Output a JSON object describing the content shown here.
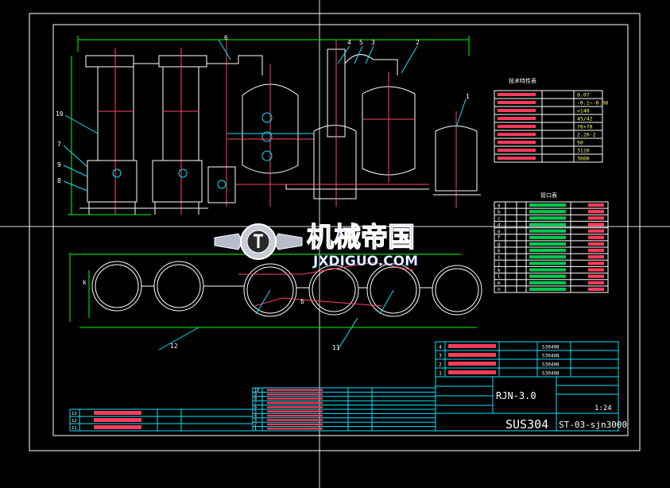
{
  "drawing": {
    "tag_numbers": [
      "10",
      "7",
      "9",
      "8",
      "6",
      "4",
      "5",
      "3",
      "2",
      "1",
      "12",
      "11"
    ],
    "view_labels": [
      "k",
      "b"
    ],
    "tech_table": {
      "title": "技术特性表",
      "rows": 9,
      "values": [
        "0.07",
        "-0.1~-0.08",
        "<140",
        "45/42",
        "78+70",
        "2.20-2",
        "50",
        "3120",
        "3000"
      ]
    },
    "nozzle_table": {
      "title": "管口表",
      "rows": 14,
      "codes": [
        "a",
        "b",
        "c",
        "d",
        "e",
        "f",
        "g",
        "h",
        "i",
        "j",
        "k",
        "l",
        "m",
        "n"
      ]
    },
    "parts_right": [
      {
        "no": "4",
        "code": "",
        "name": "",
        "material": "S30408"
      },
      {
        "no": "3",
        "code": "",
        "name": "",
        "material": "S30408"
      },
      {
        "no": "2",
        "code": "",
        "name": "",
        "material": "S30408"
      },
      {
        "no": "1",
        "code": "",
        "name": "",
        "material": "S30408"
      }
    ],
    "parts_mid": [
      "10",
      "9",
      "8",
      "7",
      "6",
      "5",
      "4",
      "3",
      "2",
      "1"
    ],
    "parts_left": [
      "13",
      "12",
      "11"
    ],
    "title_block": {
      "title": "RJN-3.0",
      "material": "SUS304",
      "drawing_no": "ST-03-sjn3000",
      "scale": "1:24"
    }
  },
  "watermark": {
    "cn": "机械帝国",
    "en": "JXDIGUO.COM",
    "emblem": "gear-emblem-icon"
  },
  "colors": {
    "bg": "#000000",
    "frame": "#ffffff",
    "vessel": "#ffffff",
    "dim": "#00ff00",
    "pipe": "#ff4466",
    "leader": "#00e5ff",
    "mark": "#ffff00"
  }
}
